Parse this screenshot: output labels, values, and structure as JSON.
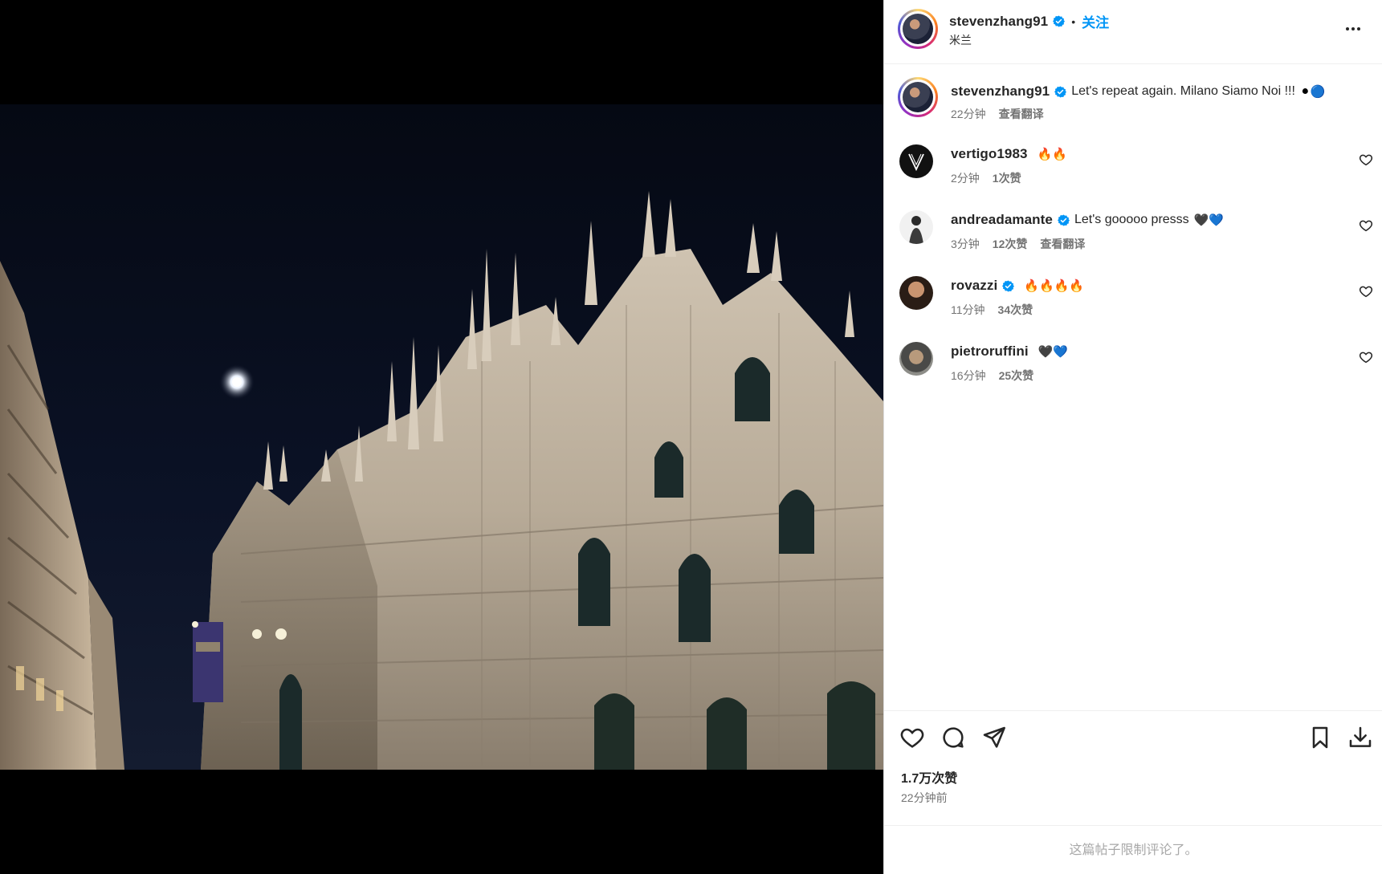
{
  "post": {
    "author": "stevenzhang91",
    "follow_label": "关注",
    "separator": "•",
    "location": "米兰"
  },
  "caption": {
    "username": "stevenzhang91",
    "text": "Let's repeat again. Milano Siamo Noi !!!",
    "emojis": "⚫🔵",
    "time": "22分钟",
    "translate": "查看翻译"
  },
  "comments": [
    {
      "username": "vertigo1983",
      "verified": false,
      "text": "",
      "emojis": "🔥🔥",
      "time": "2分钟",
      "likes": "1次赞",
      "translate": ""
    },
    {
      "username": "andreadamante",
      "verified": true,
      "text": "Let's gooooo presss",
      "emojis": "🖤💙",
      "time": "3分钟",
      "likes": "12次赞",
      "translate": "查看翻译"
    },
    {
      "username": "rovazzi",
      "verified": true,
      "text": "",
      "emojis": "🔥🔥🔥🔥",
      "time": "11分钟",
      "likes": "34次赞",
      "translate": ""
    },
    {
      "username": "pietroruffini",
      "verified": false,
      "text": "",
      "emojis": "🖤💙",
      "time": "16分钟",
      "likes": "25次赞",
      "translate": ""
    }
  ],
  "actions": {
    "likes": "1.7万次赞",
    "time": "22分钟前",
    "restricted": "这篇帖子限制评论了。"
  },
  "icons": {
    "like": "heart-icon",
    "comment": "comment-icon",
    "share": "share-icon",
    "save": "bookmark-icon",
    "download": "download-icon",
    "more": "more-options-icon",
    "verified": "verified-badge-icon"
  },
  "colors": {
    "accent": "#0095f6",
    "verified": "#0095f6",
    "muted": "#737373"
  }
}
